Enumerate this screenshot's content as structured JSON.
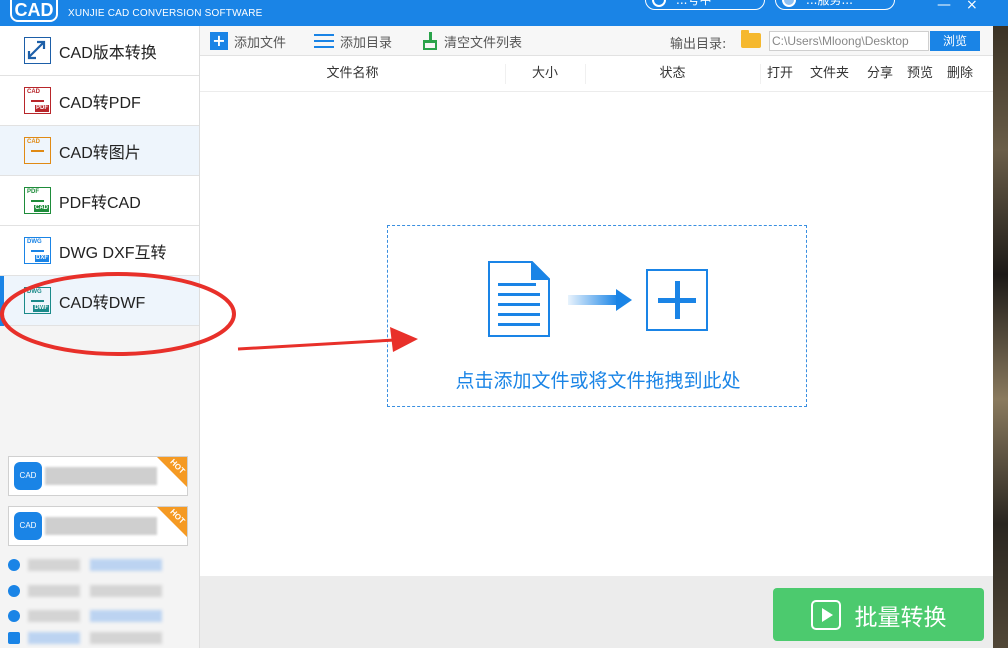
{
  "app": {
    "logo_text": "CAD",
    "subtitle": "XUNJIE CAD CONVERSION SOFTWARE",
    "pill1_text": "...号中",
    "pill2_text": "...服务...",
    "minimize": "—",
    "close": "×"
  },
  "sidebar": {
    "items": [
      {
        "label": "CAD版本转换",
        "icon_t1": "",
        "icon_t2": "",
        "colors": {
          "c1": "#1d5fa8",
          "c2": "#1d5fa8"
        }
      },
      {
        "label": "CAD转PDF",
        "icon_t1": "CAD",
        "icon_t2": "PDF",
        "colors": {
          "c1": "#b8262a",
          "c2": "#b8262a"
        }
      },
      {
        "label": "CAD转图片",
        "icon_t1": "CAD",
        "icon_t2": "",
        "colors": {
          "c1": "#e08a14",
          "c2": "#e08a14"
        }
      },
      {
        "label": "PDF转CAD",
        "icon_t1": "PDF",
        "icon_t2": "CAD",
        "colors": {
          "c1": "#1e8c3a",
          "c2": "#1e8c3a"
        }
      },
      {
        "label": "DWG DXF互转",
        "icon_t1": "DWG",
        "icon_t2": "DXF",
        "colors": {
          "c1": "#1a84e6",
          "c2": "#1a84e6"
        }
      },
      {
        "label": "CAD转DWF",
        "icon_t1": "DWG",
        "icon_t2": "DWF",
        "colors": {
          "c1": "#1a8a8a",
          "c2": "#1a8a8a"
        }
      }
    ],
    "promo": [
      {
        "icon": "CAD",
        "hot": "HOT"
      },
      {
        "icon": "CAD",
        "hot": "HOT"
      }
    ]
  },
  "toolbar": {
    "add_file": "添加文件",
    "add_dir": "添加目录",
    "clear_list": "清空文件列表",
    "output_label": "输出目录:",
    "output_path": "C:\\Users\\Mloong\\Desktop",
    "browse": "浏览"
  },
  "table": {
    "columns": [
      "文件名称",
      "大小",
      "状态",
      "打开",
      "文件夹",
      "分享",
      "预览",
      "删除"
    ]
  },
  "dropzone": {
    "text": "点击添加文件或将文件拖拽到此处"
  },
  "footer": {
    "batch_convert": "批量转换"
  },
  "colors": {
    "accent": "#1a84e6",
    "success": "#4cca6e",
    "annotation": "#e8302a"
  }
}
